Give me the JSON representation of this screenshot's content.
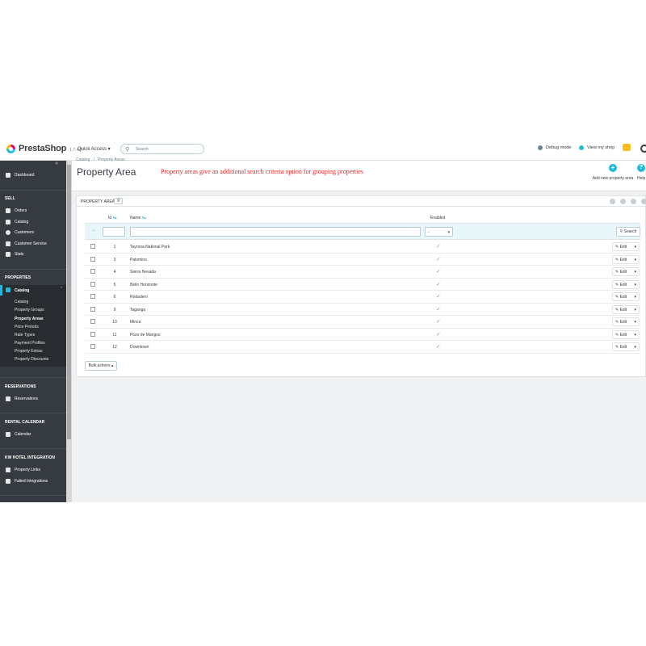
{
  "header": {
    "logo_text": "PrestaShop",
    "version": "1.7.4.2",
    "quick_access": "Quick Access ▾",
    "search_placeholder": "Search",
    "debug_mode": "Debug mode",
    "view_shop": "View my shop"
  },
  "sidebar": {
    "collapse_icon": "double-chevron-left-icon",
    "dashboard": "Dashboard",
    "sections": {
      "sell": "SELL",
      "properties": "PROPERTIES",
      "reservations": "RESERVATIONS",
      "rental_calendar": "RENTAL CALENDAR",
      "kw_hotel": "KW HOTEL INTEGRATION"
    },
    "sell_items": [
      "Orders",
      "Catalog",
      "Customers",
      "Customer Service",
      "Stats"
    ],
    "active_item": "Catalog",
    "sub_items": [
      "Catalog",
      "Property Groups",
      "Property Areas",
      "Price Periods",
      "Rate Types",
      "Payment Profiles",
      "Property Extras",
      "Property Discounts"
    ],
    "current_sub": "Property Areas",
    "reservations_items": [
      "Reservations"
    ],
    "calendar_items": [
      "Calendar"
    ],
    "kw_items": [
      "Property Links",
      "Failed Integrations"
    ]
  },
  "page": {
    "breadcrumb_root": "Catalog",
    "breadcrumb_sep": "/",
    "breadcrumb_current": "Property Areas",
    "title": "Property Area",
    "note": "Property areas give an additional search criteria option for grouping properties",
    "add_new_label": "Add new property area",
    "help_label": "Help"
  },
  "panel": {
    "title": "PROPERTY AREA",
    "count": "9",
    "columns": {
      "id": "Id",
      "name": "Name",
      "enabled": "Enabled"
    },
    "filter": {
      "dash": "--",
      "select_value": "-",
      "search_button": "Search"
    },
    "edit_label": "Edit",
    "bulk_actions": "Bulk actions ▴",
    "rows": [
      {
        "id": "1",
        "name": "Tayrona National Park",
        "enabled": true
      },
      {
        "id": "3",
        "name": "Palomino",
        "enabled": true
      },
      {
        "id": "4",
        "name": "Sierra Nevada",
        "enabled": true
      },
      {
        "id": "5",
        "name": "Bello Horizonte",
        "enabled": true
      },
      {
        "id": "6",
        "name": "Rodadero",
        "enabled": true
      },
      {
        "id": "9",
        "name": "Taganga",
        "enabled": true
      },
      {
        "id": "10",
        "name": "Minca",
        "enabled": true
      },
      {
        "id": "11",
        "name": "Pozo de Mangos",
        "enabled": true
      },
      {
        "id": "12",
        "name": "Downtown",
        "enabled": true
      }
    ]
  },
  "colors": {
    "accent": "#25b9d7",
    "sidebar_bg": "#363a41",
    "note_red": "#e02020",
    "check_green": "#70b580"
  }
}
